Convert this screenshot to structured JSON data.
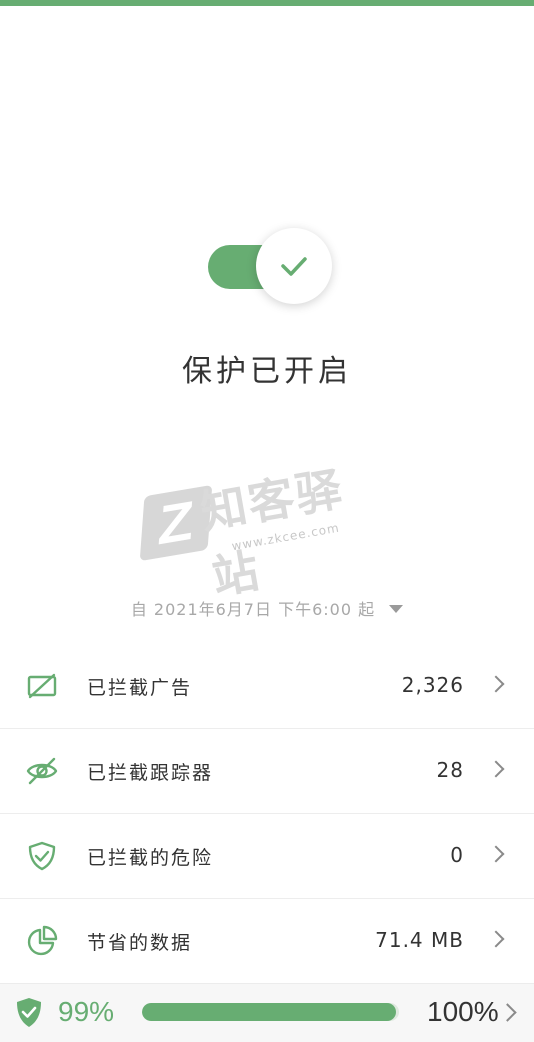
{
  "status": {
    "title": "保护已开启",
    "toggle_on": true,
    "accent_color": "#67ad72"
  },
  "watermark": {
    "logo_letter": "Z",
    "text": "知客驿站",
    "url": "www.zkcee.com"
  },
  "since": {
    "text": "自 2021年6月7日 下午6:00 起"
  },
  "stats": [
    {
      "label": "已拦截广告",
      "value": "2,326",
      "icon": "ad-block-icon"
    },
    {
      "label": "已拦截跟踪器",
      "value": "28",
      "icon": "eye-off-icon"
    },
    {
      "label": "已拦截的危险",
      "value": "0",
      "icon": "shield-check-icon"
    },
    {
      "label": "节省的数据",
      "value": "71.4 MB",
      "icon": "pie-chart-icon"
    }
  ],
  "bottom": {
    "percent_label": "99%",
    "progress": 0.99,
    "total_label": "100%",
    "icon": "shield-check-filled-icon"
  }
}
